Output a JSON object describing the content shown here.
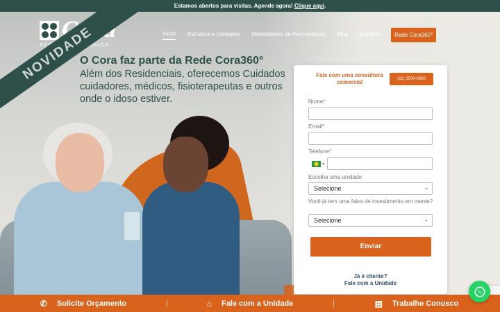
{
  "topbar": {
    "text": "Estamos abertos para visitas. Agende agora!",
    "link": "Clique aqui"
  },
  "logo": {
    "name": "Cora",
    "subtitle": "RESIDENCIAL SENIOR"
  },
  "nav": {
    "items": [
      "Início",
      "Estrutura e Unidades",
      "Modalidades de Permanência",
      "Blog",
      "Contato"
    ],
    "cta": "Rede Cora360°"
  },
  "ribbon": "NOVIDADE",
  "hero": {
    "title": "O Cora faz parte da Rede Cora360°",
    "lines": [
      "Além dos Residenciais, oferecemos Cuidados",
      "cuidadores, médicos, fisioterapeutas e outros",
      "onde o idoso estiver."
    ]
  },
  "form": {
    "title": "Fale com uma consultora comercial",
    "phone_button": "(11) 2500-0800",
    "name_label": "Nome*",
    "email_label": "Email*",
    "phone_label": "Telefone*",
    "unit_label": "Escolha uma unidade",
    "unit_value": "Selecione",
    "invest_label": "Você já tem uma faixa de investimento em mente?",
    "invest_value": "Selecione",
    "submit": "Enviar",
    "client_q": "Já é cliente?",
    "client_link": "Fale com a Unidade"
  },
  "bottombar": [
    {
      "label": "Solicite Orçamento",
      "icon": "phone-icon"
    },
    {
      "label": "Fale com a Unidade",
      "icon": "home-icon"
    },
    {
      "label": "Trabalhe Conosco",
      "icon": "id-card-icon"
    }
  ],
  "colors": {
    "brand_green": "#2f4f4a",
    "accent_orange": "#d9621c",
    "whatsapp": "#25d366"
  }
}
